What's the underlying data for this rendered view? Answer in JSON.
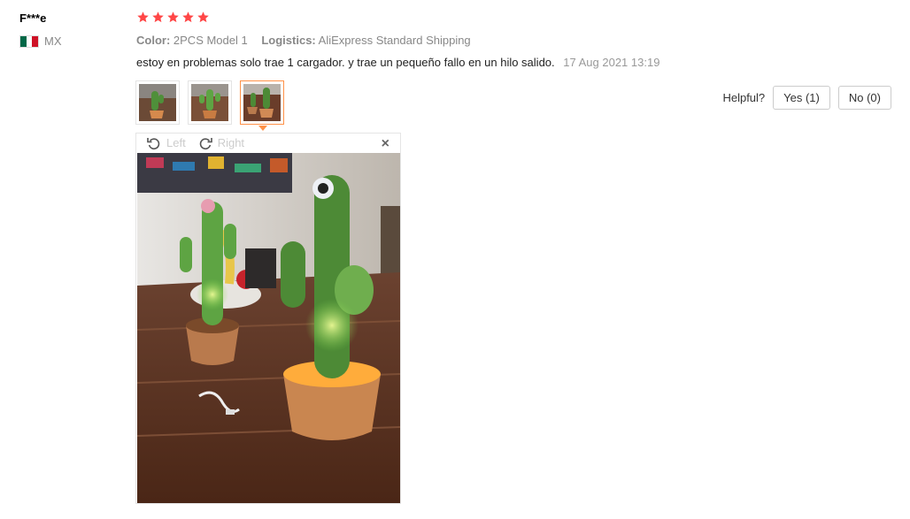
{
  "reviewer": {
    "name": "F***e",
    "country_code": "MX",
    "rating": 5,
    "star_color": "#ff4747"
  },
  "meta": {
    "color_label": "Color:",
    "color_value": "2PCS Model 1",
    "logistics_label": "Logistics:",
    "logistics_value": "AliExpress Standard Shipping"
  },
  "review": {
    "text": "estoy en problemas solo trae 1 cargador. y trae un pequeño fallo en un hilo salido.",
    "date": "17 Aug 2021 13:19"
  },
  "images": {
    "thumbnails": [
      {
        "icon": "thumb-cactus-photo-1",
        "active": false
      },
      {
        "icon": "thumb-cactus-photo-2",
        "active": false
      },
      {
        "icon": "thumb-cactus-photo-3",
        "active": true
      }
    ],
    "viewer": {
      "rotate_left_label": "Left",
      "rotate_right_label": "Right",
      "close_label": "×"
    }
  },
  "helpful": {
    "label": "Helpful?",
    "yes_label": "Yes (1)",
    "no_label": "No (0)"
  }
}
